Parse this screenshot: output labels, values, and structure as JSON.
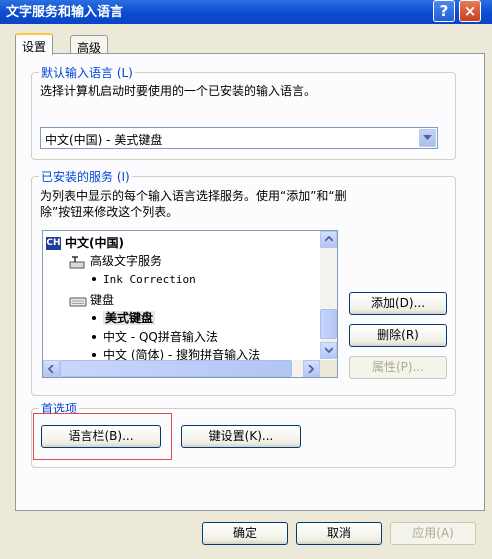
{
  "window": {
    "title": "文字服务和输入语言",
    "help_glyph": "?",
    "close_glyph": "×"
  },
  "tabs": [
    {
      "label": "设置",
      "active": true
    },
    {
      "label": "高级",
      "active": false
    }
  ],
  "default_language": {
    "legend": "默认输入语言 (L)",
    "description": "选择计算机启动时要使用的一个已安装的输入语言。",
    "selected": "中文(中国) - 美式键盘"
  },
  "installed_services": {
    "legend": "已安装的服务 (I)",
    "description_line1": "为列表中显示的每个输入语言选择服务。使用“添加”和“删",
    "description_line2": "除”按钮来修改这个列表。",
    "tree": {
      "language": "中文(中国)",
      "language_icon": "CH",
      "text_services_group": "高级文字服务",
      "ink_correction": "Ink Correction",
      "keyboard_group": "键盘",
      "us_keyboard": "美式键盘",
      "qq_pinyin": "中文 - QQ拼音输入法",
      "sogou_pinyin": "中文 (简体) - 搜狗拼音输入法"
    },
    "buttons": {
      "add": "添加(D)...",
      "remove": "删除(R)",
      "properties": "属性(P)..."
    }
  },
  "preferences": {
    "legend": "首选项",
    "language_bar_button": "语言栏(B)...",
    "key_settings_button": "键设置(K)..."
  },
  "footer": {
    "ok": "确定",
    "cancel": "取消",
    "apply": "应用(A)"
  },
  "colors": {
    "title_bar": "#0b4bd0",
    "group_label": "#0046d5",
    "highlight_box": "#e34b4b",
    "dialog_bg": "#ece9d8"
  },
  "icons": [
    "help-icon",
    "close-icon",
    "dropdown-arrow-icon",
    "keyboard-language-icon",
    "text-services-icon",
    "keyboard-icon",
    "scroll-up-icon",
    "scroll-down-icon",
    "scroll-left-icon",
    "scroll-right-icon"
  ]
}
